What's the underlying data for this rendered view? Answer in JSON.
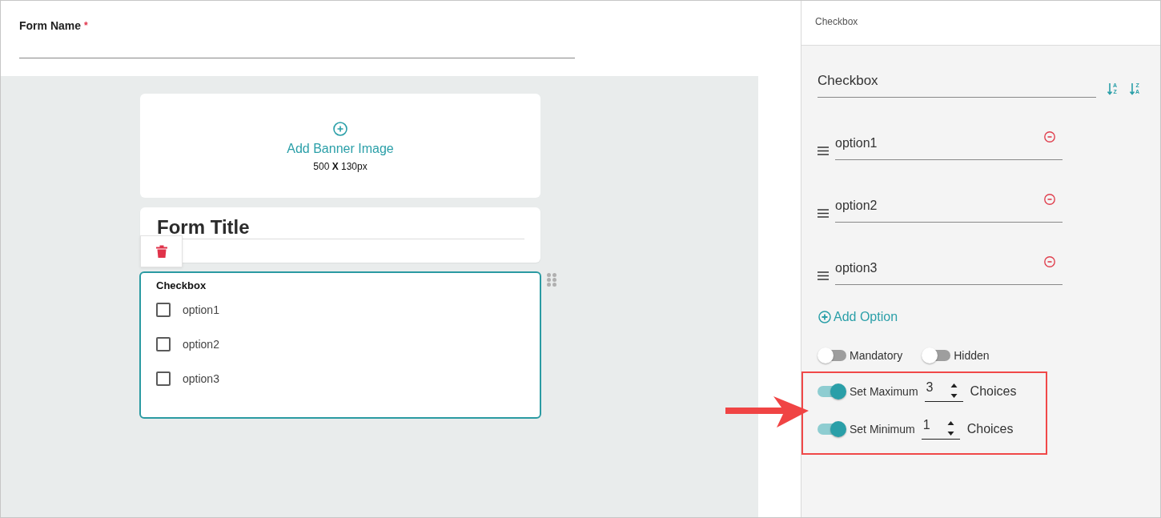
{
  "form_name": {
    "label": "Form Name",
    "required_mark": "*"
  },
  "banner": {
    "label": "Add Banner Image",
    "size": "500 **X** 130px"
  },
  "form_title": "Form Title",
  "checkbox_field": {
    "label": "Checkbox",
    "options": [
      {
        "label": "option1",
        "checked": false
      },
      {
        "label": "option2",
        "checked": false
      },
      {
        "label": "option3",
        "checked": false
      }
    ]
  },
  "properties": {
    "header": "Checkbox",
    "name": "Checkbox",
    "sort_buttons": [
      {
        "letters": [
          "A",
          "Z"
        ]
      },
      {
        "letters": [
          "Z",
          "A"
        ]
      }
    ],
    "options": [
      "option1",
      "option2",
      "option3"
    ],
    "add_option": "Add Option",
    "switches": [
      {
        "label": "Mandatory",
        "on": false
      },
      {
        "label": "Hidden",
        "on": false
      }
    ],
    "limits": [
      {
        "label": "Set Maximum",
        "on": true,
        "value": "3",
        "unit": "Choices"
      },
      {
        "label": "Set Minimum",
        "on": true,
        "value": "1",
        "unit": "Choices"
      }
    ]
  }
}
